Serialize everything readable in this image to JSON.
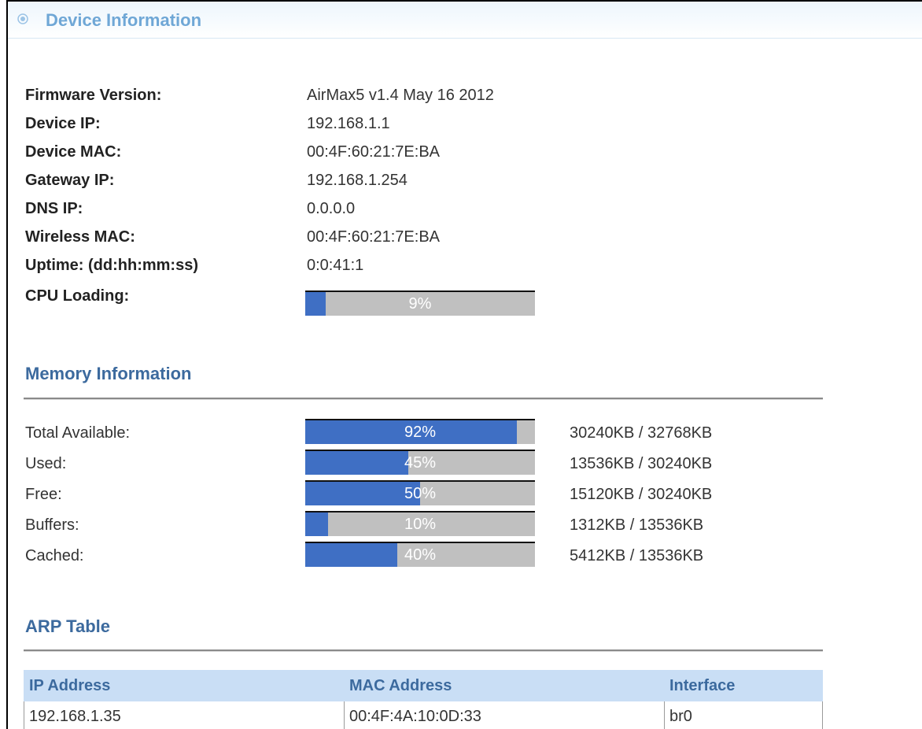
{
  "header": {
    "title": "Device Information"
  },
  "device": {
    "rows": [
      {
        "label": "Firmware Version:",
        "value": "AirMax5 v1.4 May 16 2012"
      },
      {
        "label": "Device IP:",
        "value": "192.168.1.1"
      },
      {
        "label": "Device MAC:",
        "value": "00:4F:60:21:7E:BA"
      },
      {
        "label": "Gateway IP:",
        "value": "192.168.1.254"
      },
      {
        "label": "DNS IP:",
        "value": "0.0.0.0"
      },
      {
        "label": "Wireless MAC:",
        "value": "00:4F:60:21:7E:BA"
      },
      {
        "label": "Uptime: (dd:hh:mm:ss)",
        "value": "0:0:41:1"
      }
    ],
    "cpu": {
      "label": "CPU Loading:",
      "percent_text": "9%",
      "fraction": 0.09
    }
  },
  "memory": {
    "title": "Memory Information",
    "rows": [
      {
        "label": "Total Available:",
        "percent_text": "92%",
        "fraction": 0.92,
        "kb": "30240KB / 32768KB"
      },
      {
        "label": "Used:",
        "percent_text": "45%",
        "fraction": 0.45,
        "kb": "13536KB / 30240KB"
      },
      {
        "label": "Free:",
        "percent_text": "50%",
        "fraction": 0.5,
        "kb": "15120KB / 30240KB"
      },
      {
        "label": "Buffers:",
        "percent_text": "10%",
        "fraction": 0.1,
        "kb": "1312KB / 13536KB"
      },
      {
        "label": "Cached:",
        "percent_text": "40%",
        "fraction": 0.4,
        "kb": "5412KB / 13536KB"
      }
    ]
  },
  "arp": {
    "title": "ARP Table",
    "columns": [
      "IP Address",
      "MAC Address",
      "Interface"
    ],
    "rows": [
      [
        "192.168.1.35",
        "00:4F:4A:10:0D:33",
        "br0"
      ]
    ]
  },
  "colors": {
    "bar_fill": "#3f6fc4",
    "bar_track": "#c0c0c0",
    "section_title": "#3c6a9e",
    "header_title": "#6fa7d6",
    "table_header_bg": "#c9def5"
  },
  "icons": {
    "title_icon": "target-circle-icon"
  }
}
